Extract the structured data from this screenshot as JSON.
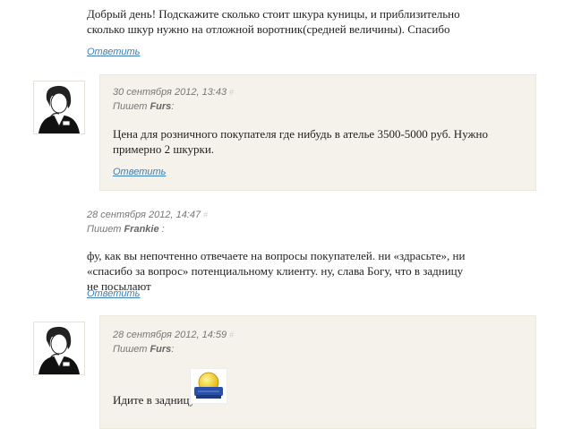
{
  "comments": [
    {
      "text": "Добрый день! Подскажите сколько стоит шкура куницы, и приблизительно сколько шкур нужно на отложной воротник(средней величины). Спасибо",
      "reply_label": "Ответить"
    },
    {
      "date": "30 сентября 2012, 13:43",
      "hash": "#",
      "writes_label": "Пишет",
      "author": "Furs",
      "author_suffix": ":",
      "text": "Цена для розничного покупателя где нибудь в ателье 3500-5000 руб. Нужно примерно 2 шкурки.",
      "reply_label": "Ответить"
    },
    {
      "date": "28 сентября 2012, 14:47",
      "hash": "#",
      "writes_label": "Пишет",
      "author": "Frankie",
      "author_suffix": " :",
      "text": "фу, как вы непочтенно отвечаете на вопросы покупателей. ни «здрасьте», ни «спасибо за вопрос» потенциальному клиенту. ну, слава Богу, что в задницу не посылают",
      "reply_label": "Ответить"
    },
    {
      "date": "28 сентября 2012, 14:59",
      "hash": "#",
      "writes_label": "Пишет",
      "author": "Furs",
      "author_suffix": ":",
      "text": "Идите в задницу."
    }
  ],
  "icons": {
    "avatar": "person-avatar-icon",
    "smiley": "smiley-icon"
  },
  "colors": {
    "bubble": "#f4f2ea",
    "link": "#3d7fb1",
    "meta": "#777777",
    "text": "#222222"
  }
}
